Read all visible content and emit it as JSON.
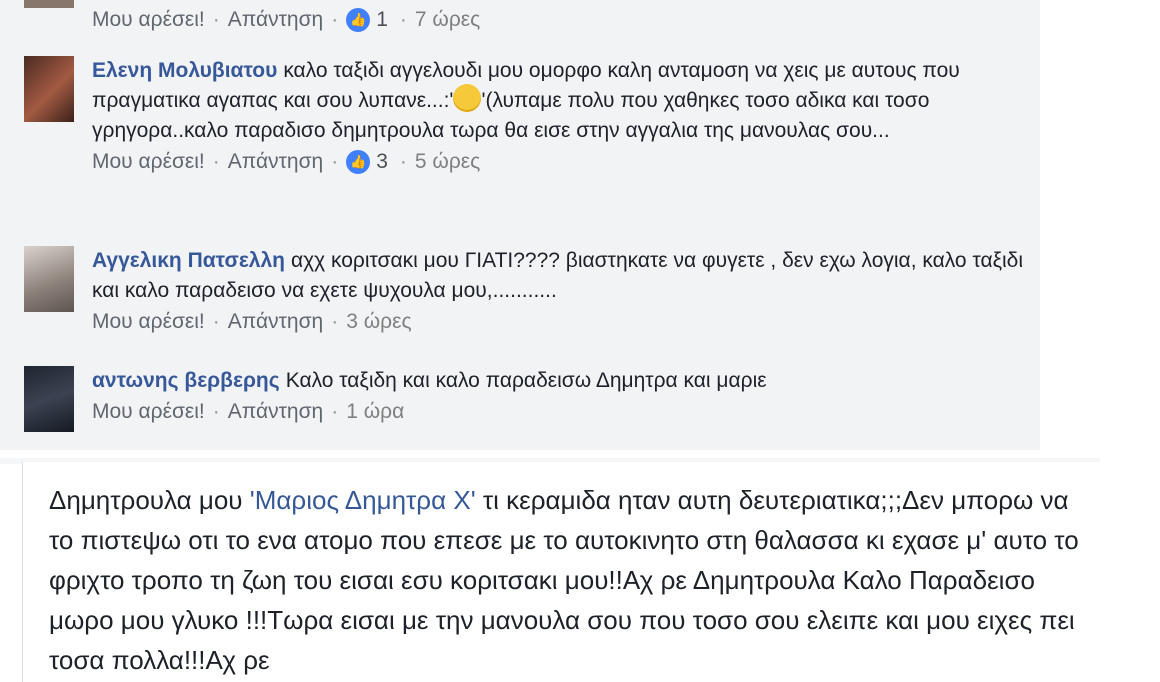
{
  "comments": [
    {
      "author": "",
      "text": "",
      "like_label": "Μου αρέσει!",
      "reply_label": "Απάντηση",
      "reactions": "1",
      "time": "7 ώρες"
    },
    {
      "author": "Ελενη Μολυβιατου",
      "text_before": "καλο ταξιδι αγγελουδι μου ομορφο καλη ανταμοση να χεις με αυτους που πραγματικα αγαπας και σου λυπανε...:'",
      "text_after": "'(λυπαμε πολυ που χαθηκες τοσο αδικα και τοσο γρηγορα..καλο παραδισο δημητρουλα τωρα θα εισε στην αγγαλια της μανουλας σου...",
      "like_label": "Μου αρέσει!",
      "reply_label": "Απάντηση",
      "reactions": "3",
      "time": "5 ώρες"
    },
    {
      "author": "Αγγελικη Πατσελλη",
      "text": "αχχ κοριτσακι μου ΓΙΑΤΙ???? βιαστηκατε να φυγετε , δεν εχω λογια, καλο ταξιδι και καλο παραδεισο να εχετε ψυχουλα μου,...........",
      "like_label": "Μου αρέσει!",
      "reply_label": "Απάντηση",
      "time": "3 ώρες"
    },
    {
      "author": "αντωνης βερβερης",
      "text": "Καλο ταξιδη και καλο παραδεισω Δημητρα και μαριε",
      "like_label": "Μου αρέσει!",
      "reply_label": "Απάντηση",
      "time": "1 ώρα"
    }
  ],
  "post": {
    "text_before": "Δημητρουλα μου ",
    "mention": "'Μαριος Δημητρα Χ'",
    "text_after": " τι κεραμιδα ηταν αυτη δευτεριατικα;;;Δεν μπορω να το πιστεψω οτι το ενα ατομο που επεσε με το αυτοκινητο στη θαλασσα κι εχασε μ' αυτο το φριχτο τροπο τη ζωη του εισαι εσυ κοριτσακι μου!!Αχ ρε Δημητρουλα Καλο Παραδεισο μωρο μου γλυκο !!!Τωρα εισαι με την μανουλα σου που τοσο σου ελειπε και μου ειχες πει τοσα πολλα!!!Αχ ρε"
  },
  "colors": {
    "author": "#365899",
    "like_badge": "#4080ff",
    "panel_bg": "#f2f3f5"
  }
}
